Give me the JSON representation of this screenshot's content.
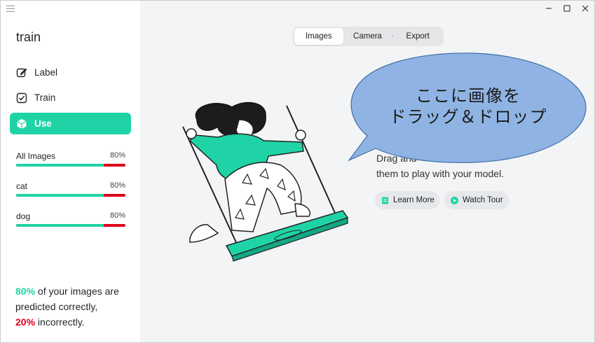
{
  "app": {
    "title": "train"
  },
  "sidebar": {
    "nav": [
      {
        "label": "Label",
        "icon": "edit-icon"
      },
      {
        "label": "Train",
        "icon": "checkbox-icon"
      },
      {
        "label": "Use",
        "icon": "cube-icon",
        "active": true
      }
    ],
    "stats": [
      {
        "label": "All Images",
        "percent_text": "80%",
        "correct": 0.8
      },
      {
        "label": "cat",
        "percent_text": "80%",
        "correct": 0.8
      },
      {
        "label": "dog",
        "percent_text": "80%",
        "correct": 0.8
      }
    ],
    "summary": {
      "good_pct": "80%",
      "good_text": " of your images are predicted correctly,",
      "bad_pct": "20%",
      "bad_text": " incorrectly."
    }
  },
  "tabs": [
    {
      "label": "Images",
      "active": true
    },
    {
      "label": "Camera"
    },
    {
      "label": "Export"
    }
  ],
  "main": {
    "description_line1": "Drag and",
    "description_line2": "them to play with your model.",
    "learn_more": "Learn More",
    "watch_tour": "Watch Tour"
  },
  "callout": {
    "line1": "ここに画像を",
    "line2": "ドラッグ＆ドロップ"
  },
  "colors": {
    "accent": "#1fd3a6",
    "error": "#e0001b",
    "callout_fill": "#8fb4e3"
  }
}
